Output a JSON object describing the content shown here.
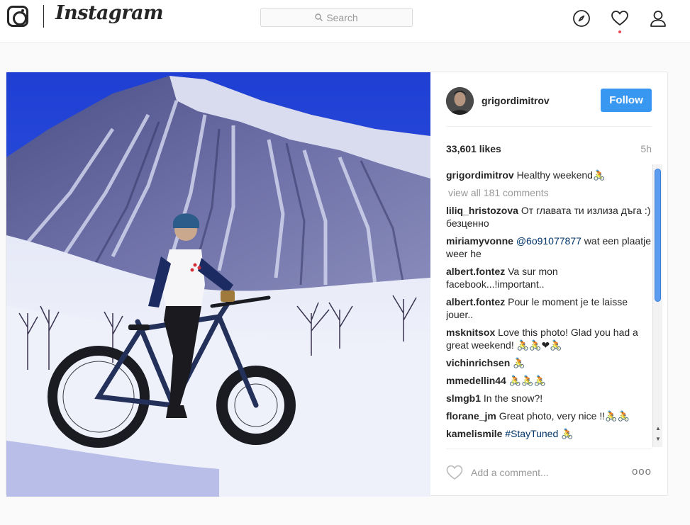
{
  "nav": {
    "brand": "Instagram",
    "search_placeholder": "Search",
    "icons": [
      "instagram-logo-icon",
      "search-icon",
      "compass-icon",
      "heart-icon",
      "profile-icon"
    ],
    "notification_dot_color": "#ed4956"
  },
  "post": {
    "username": "grigordimitrov",
    "follow_label": "Follow",
    "likes": "33,601 likes",
    "time": "5h",
    "caption_user": "grigordimitrov",
    "caption_text": "Healthy weekend🚴",
    "view_all": "view all 181 comments",
    "comments": [
      {
        "user": "liliq_hristozova",
        "text": "От главата ти излиза дъга :) безценно"
      },
      {
        "user": "miriamyvonne",
        "mention": "@6o91077877",
        "text": "wat een plaatje weer he"
      },
      {
        "user": "albert.fontez",
        "text": "Va sur mon facebook...!important.."
      },
      {
        "user": "albert.fontez",
        "text": "Pour le moment je te laisse jouer.."
      },
      {
        "user": "msknitsox",
        "text": "Love this photo! Glad you had a great weekend! 🚴🚴❤🚴"
      },
      {
        "user": "vichinrichsen",
        "text": "🚴"
      },
      {
        "user": "mmedellin44",
        "text": "🚴🚴🚴"
      },
      {
        "user": "slmgb1",
        "text": "In the snow?!"
      },
      {
        "user": "florane_jm",
        "text": "Great photo, very nice !!🚴🚴"
      },
      {
        "user": "kamelismile",
        "mention": "#StayTuned",
        "text": "🚴"
      }
    ],
    "add_comment_placeholder": "Add a comment...",
    "more_label": "ooo",
    "accent": "#3897f0"
  }
}
